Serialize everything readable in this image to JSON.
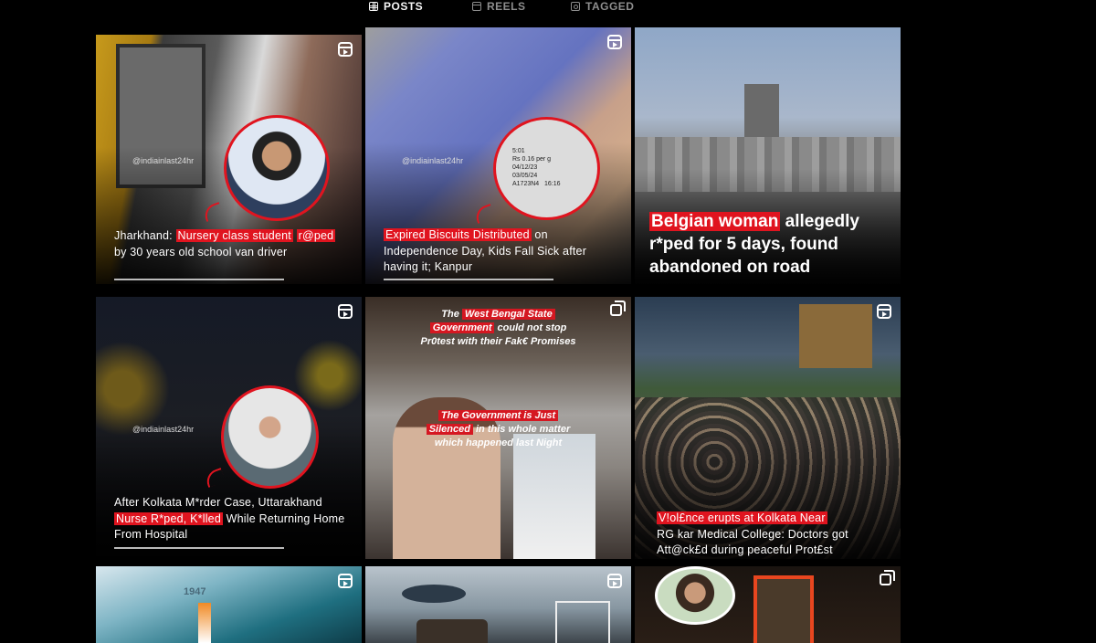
{
  "tabs": [
    {
      "label": "POSTS",
      "icon": "grid-icon",
      "active": true
    },
    {
      "label": "REELS",
      "icon": "reels-icon",
      "active": false
    },
    {
      "label": "TAGGED",
      "icon": "tagged-icon",
      "active": false
    }
  ],
  "posts": [
    {
      "type": "reel",
      "handle": "@indiainlast24hr",
      "caption_a": "Jharkhand: ",
      "caption_hl1": "Nursery class student",
      "caption_hl2": "r@ped",
      "caption_b": " by 30 years old school van driver"
    },
    {
      "type": "reel",
      "handle": "@indiainlast24hr",
      "caption_hl1": "Expired Biscuits Distributed",
      "caption_b": " on Independence Day, Kids Fall Sick after having it; Kanpur",
      "label_text": "5:01\nRs 0.16 per g\n04/12/23\n03/05/24\nA1723N4   16:16"
    },
    {
      "type": "image",
      "title_hl": "Belgian woman",
      "title_b": " allegedly r*ped for 5 days, found abandoned on road"
    },
    {
      "type": "reel",
      "handle": "@indiainlast24hr",
      "caption_a": "After Kolkata M*rder Case, Uttarakhand ",
      "caption_hl1": "Nurse R*ped, K*lled",
      "caption_b": " While Returning Home From Hospital"
    },
    {
      "type": "carousel",
      "top_a": "The ",
      "top_hl1": "West Bengal State",
      "top_hl2": "Government",
      "top_b": " could not stop",
      "top_c": "Pr0test with their Fak€ Promises",
      "mid_hl": "The Government is Just",
      "mid_hl2": "Silenced",
      "mid_b": " in this whole matter",
      "mid_c": "which happened last Night"
    },
    {
      "type": "reel",
      "caption_hl1": "V!ol£nce erupts at Kolkata Near",
      "caption_b": "RG kar Medical College: Doctors got Att@ck£d during peaceful Prot£st"
    },
    {
      "type": "reel",
      "overlay_text": "1947"
    },
    {
      "type": "reel"
    },
    {
      "type": "carousel"
    }
  ],
  "colors": {
    "highlight": "#e0141f",
    "background": "#000000",
    "tab_active": "#f5f5f5",
    "tab_inactive": "#8e8e8e"
  }
}
